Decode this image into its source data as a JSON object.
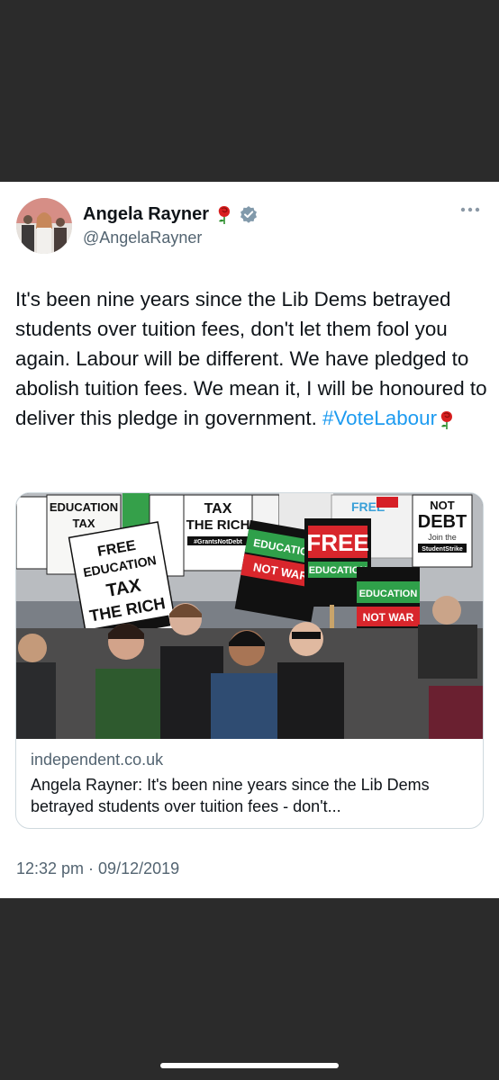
{
  "author": {
    "name": "Angela Rayner",
    "handle": "@AngelaRayner",
    "verified": true
  },
  "icons": {
    "name_badge": "rose-icon",
    "verified": "verified-badge-icon",
    "menu": "more-options-icon"
  },
  "tweet": {
    "text": "It's been nine years since the Lib Dems betrayed students over tuition fees, don't let them fool you again. Labour will be different. We have pledged to abolish tuition fees. We mean it, I will be honoured to deliver this pledge in government. ",
    "hashtag": "#VoteLabour",
    "timestamp": "12:32 pm · 09/12/2019"
  },
  "link_card": {
    "domain": "independent.co.uk",
    "title": "Angela Rayner: It's been nine years since the Lib Dems betrayed students over tuition fees - don't..."
  },
  "photo_signs": {
    "free_education": "FREE EDUCATION",
    "tax_the_rich": "TAX THE RICH",
    "tax": "TAX",
    "the_rich": "THE RICH",
    "education": "EDUCATION",
    "not_war": "NOT WAR",
    "free": "FREE",
    "not": "NOT",
    "debt": "DEBT",
    "grants_not_debt": "#GrantsNotDebt",
    "join_the": "Join the",
    "student_strike": "StudentStrike"
  },
  "colors": {
    "background": "#2b2b2b",
    "card": "#ffffff",
    "text": "#0f1419",
    "secondary": "#536471",
    "link": "#1d9bf0",
    "verified": "#829aab"
  }
}
